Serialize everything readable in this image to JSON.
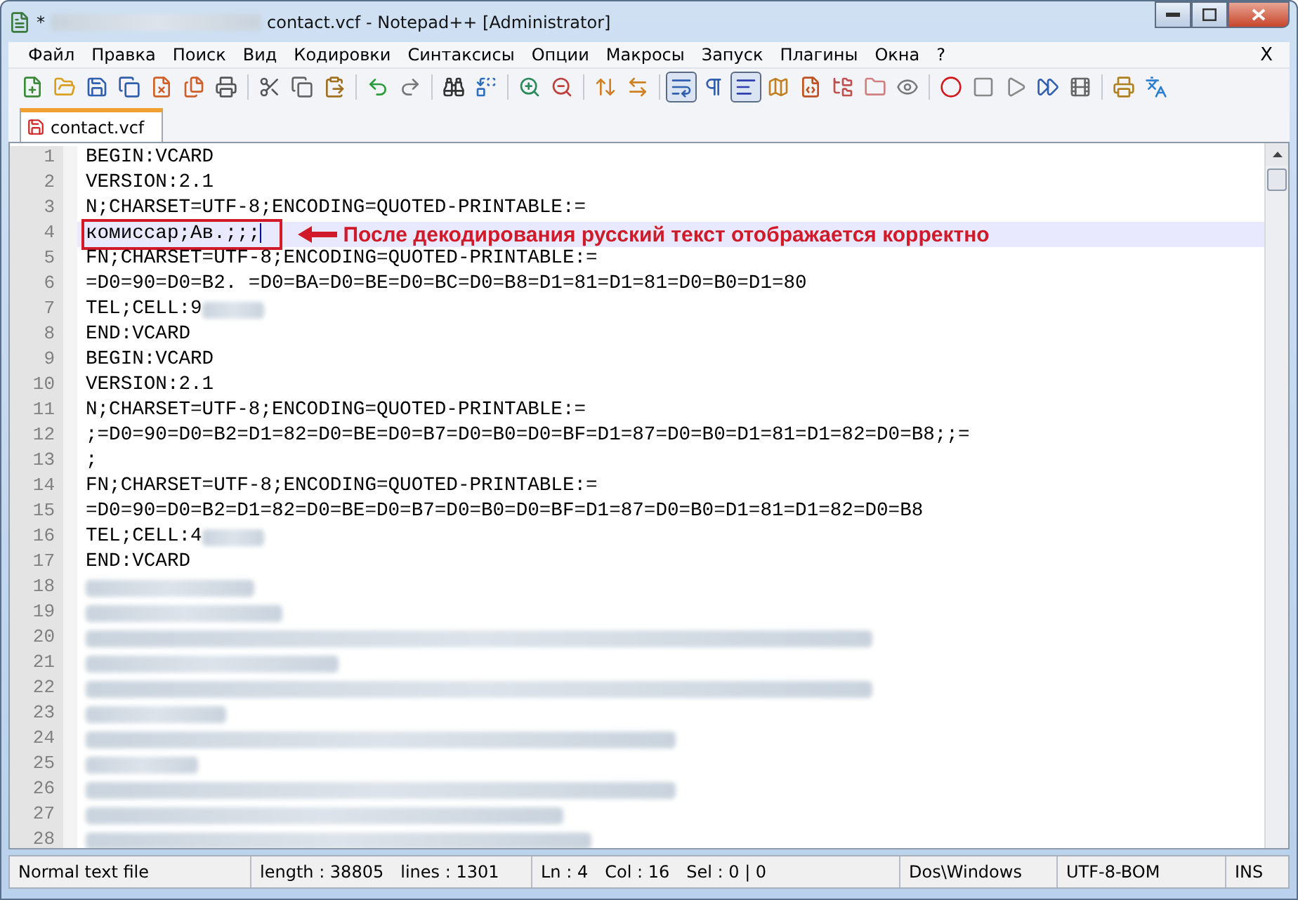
{
  "window": {
    "title_prefix": "*",
    "title": "contact.vcf - Notepad++ [Administrator]"
  },
  "menu": {
    "items": [
      "Файл",
      "Правка",
      "Поиск",
      "Вид",
      "Кодировки",
      "Синтаксисы",
      "Опции",
      "Макросы",
      "Запуск",
      "Плагины",
      "Окна",
      "?"
    ],
    "close_label": "X"
  },
  "toolbar_buttons": [
    {
      "pressed": false
    },
    {
      "pressed": false
    },
    {
      "pressed": false
    },
    {
      "pressed": false
    },
    {
      "pressed": false
    },
    {
      "pressed": false
    },
    {
      "pressed": false
    },
    {
      "pressed": false
    },
    {
      "pressed": false
    },
    {
      "pressed": false
    },
    {
      "pressed": false
    },
    {
      "pressed": false
    },
    {
      "pressed": false
    },
    {
      "pressed": false
    },
    {
      "pressed": false
    },
    {
      "pressed": false
    },
    {
      "pressed": false
    },
    {
      "pressed": false
    },
    {
      "pressed": true
    },
    {
      "pressed": false
    },
    {
      "pressed": true
    },
    {
      "pressed": false
    },
    {
      "pressed": false
    },
    {
      "pressed": false
    },
    {
      "pressed": false
    },
    {
      "pressed": false
    },
    {
      "pressed": false
    },
    {
      "pressed": false
    },
    {
      "pressed": false
    },
    {
      "pressed": false
    },
    {
      "pressed": false
    },
    {
      "pressed": false
    },
    {
      "pressed": false
    }
  ],
  "tabs": [
    {
      "label": "contact.vcf",
      "selected": true
    }
  ],
  "editor": {
    "lines": [
      {
        "number": "1",
        "kind": "text",
        "text": "BEGIN:VCARD",
        "current": false
      },
      {
        "number": "2",
        "kind": "text",
        "text": "VERSION:2.1",
        "current": false
      },
      {
        "number": "3",
        "kind": "text",
        "text": "N;CHARSET=UTF-8;ENCODING=QUOTED-PRINTABLE:=",
        "current": false
      },
      {
        "number": "4",
        "kind": "text",
        "text": "комиссар;Ав.;;;",
        "current": true,
        "boxed": true,
        "annotation": "После декодирования русский текст отображается корректно"
      },
      {
        "number": "5",
        "kind": "text",
        "text": "FN;CHARSET=UTF-8;ENCODING=QUOTED-PRINTABLE:=",
        "current": false
      },
      {
        "number": "6",
        "kind": "text",
        "text": "=D0=90=D0=B2. =D0=BA=D0=BE=D0=BC=D0=B8=D1=81=D1=81=D0=B0=D1=80",
        "current": false
      },
      {
        "number": "7",
        "kind": "redacted_tail",
        "text": "TEL;CELL:9",
        "current": false
      },
      {
        "number": "8",
        "kind": "text",
        "text": "END:VCARD",
        "current": false
      },
      {
        "number": "9",
        "kind": "text",
        "text": "BEGIN:VCARD",
        "current": false
      },
      {
        "number": "10",
        "kind": "text",
        "text": "VERSION:2.1",
        "current": false
      },
      {
        "number": "11",
        "kind": "text",
        "text": "N;CHARSET=UTF-8;ENCODING=QUOTED-PRINTABLE:=",
        "current": false
      },
      {
        "number": "12",
        "kind": "text",
        "text": ";=D0=90=D0=B2=D1=82=D0=BE=D0=B7=D0=B0=D0=BF=D1=87=D0=B0=D1=81=D1=82=D0=B8;;=",
        "current": false
      },
      {
        "number": "13",
        "kind": "text",
        "text": ";",
        "current": false
      },
      {
        "number": "14",
        "kind": "text",
        "text": "FN;CHARSET=UTF-8;ENCODING=QUOTED-PRINTABLE:=",
        "current": false
      },
      {
        "number": "15",
        "kind": "text",
        "text": "=D0=90=D0=B2=D1=82=D0=BE=D0=B7=D0=B0=D0=BF=D1=87=D0=B0=D1=81=D1=82=D0=B8",
        "current": false
      },
      {
        "number": "16",
        "kind": "redacted_tail",
        "text": "TEL;CELL:4",
        "current": false
      },
      {
        "number": "17",
        "kind": "text",
        "text": "END:VCARD",
        "current": false
      },
      {
        "number": "18",
        "kind": "redacted",
        "current": false
      },
      {
        "number": "19",
        "kind": "redacted",
        "current": false
      },
      {
        "number": "20",
        "kind": "redacted",
        "current": false
      },
      {
        "number": "21",
        "kind": "redacted",
        "current": false
      },
      {
        "number": "22",
        "kind": "redacted",
        "current": false
      },
      {
        "number": "23",
        "kind": "redacted",
        "current": false
      },
      {
        "number": "24",
        "kind": "redacted",
        "current": false
      },
      {
        "number": "25",
        "kind": "redacted",
        "current": false
      },
      {
        "number": "26",
        "kind": "redacted",
        "current": false
      },
      {
        "number": "27",
        "kind": "redacted",
        "current": false
      },
      {
        "number": "28",
        "kind": "redacted",
        "current": false
      }
    ]
  },
  "status_bar": [
    [
      "Normal text file"
    ],
    [
      "length : 38805",
      "lines : 1301"
    ],
    [
      "Ln : 4",
      "Col : 16",
      "Sel : 0 | 0"
    ],
    [
      "Dos\\Windows"
    ],
    [
      "UTF-8-BOM"
    ],
    [
      "INS"
    ]
  ]
}
